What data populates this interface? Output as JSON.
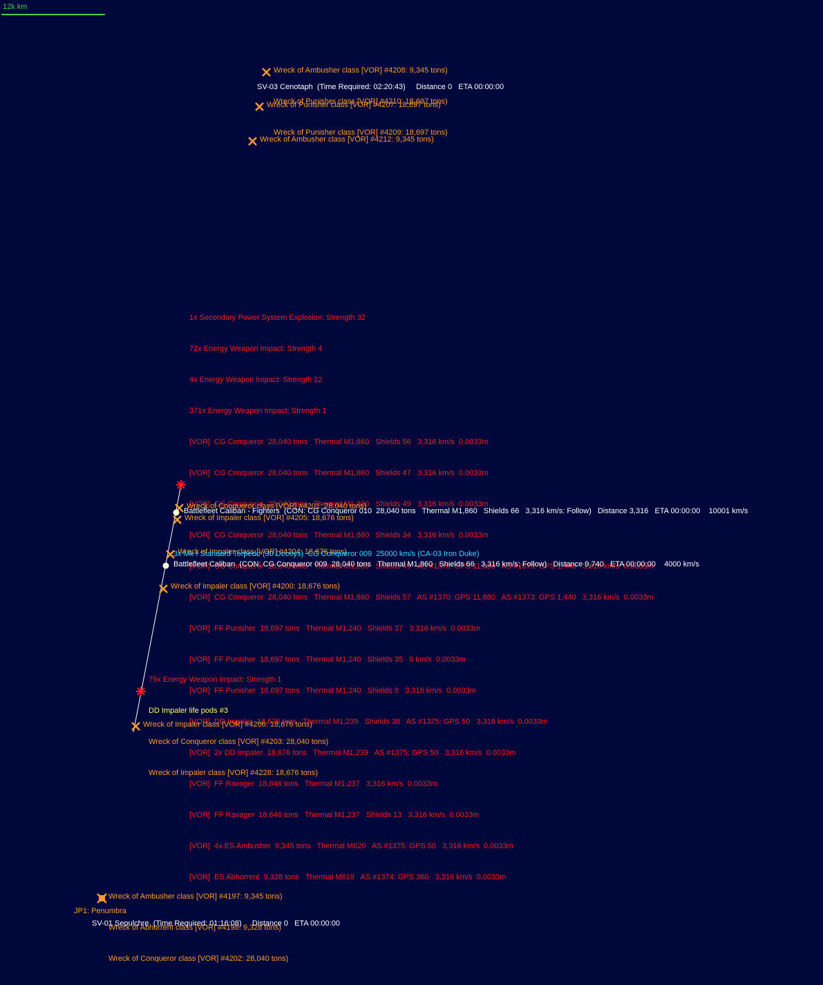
{
  "scale": {
    "label": "12k km"
  },
  "colors": {
    "background": "#00073a",
    "wreck": "#ff9c28",
    "impact": "#ff1c1c",
    "fleet": "#ffffff",
    "life_pod": "#ffff60",
    "missile": "#40d8ff",
    "scale_bar": "#3cd23c"
  },
  "icons": {
    "wreck": "x-cross-icon",
    "impact": "starburst-icon",
    "fleet": "dot-icon",
    "jump_point": "square-x-icon"
  },
  "top_cluster": {
    "wrecks": [
      "Wreck of Ambusher class [VOR] #4208: 9,345 tons)",
      "Wreck of Punisher class [VOR] #4210: 18,697 tons)",
      "Wreck of Punisher class [VOR] #4209: 18,697 tons)"
    ],
    "waypoint": "SV-03 Cenotaph  (Time Required: 02:20:43)     Distance 0   ETA 00:00:00"
  },
  "wreck_4207": "Wreck of Punisher class [VOR] #4207: 18,697 tons)",
  "wreck_4212": "Wreck of Ambusher class [VOR] #4212: 9,345 tons)",
  "combat_log": [
    "1x Secondary Power System Explosion: Strength 32",
    "72x Energy Weapon Impact: Strength 4",
    "4x Energy Weapon Impact: Strength 12",
    "371x Energy Weapon Impact: Strength 1",
    "[VOR]  CG Conqueror  28,040 tons   Thermal M1,860   Shields 56   3,316 km/s  0.0033m",
    "[VOR]  CG Conqueror  28,040 tons   Thermal M1,860   Shields 47   3,316 km/s  0.0033m",
    "[VOR]  CG Conqueror  28,040 tons   Thermal M1,860   Shields 49   3,316 km/s  0.0033m",
    "[VOR]  CG Conqueror  28,040 tons   Thermal M1,860   Shields 34   3,316 km/s  0.0033m",
    "[VOR]  CG Conqueror  28,040 tons   Thermal M1,860   Shields 49   AS #1370: GPS 11,880   AS #1373: GPS 1,440   3,316 km/s  0.0033m",
    "[VOR]  CG Conqueror  28,040 tons   Thermal M1,860   Shields 57   AS #1370: GPS 11,880   AS #1373: GPS 1,440   3,316 km/s  0.0033m",
    "[VOR]  FF Punisher  18,697 tons   Thermal M1,240   Shields 37   3,316 km/s  0.0033m",
    "[VOR]  FF Punisher  18,697 tons   Thermal M1,240   Shields 35   0 km/s  0.0033m",
    "[VOR]  FF Punisher  18,697 tons   Thermal M1,240   Shields 8   3,316 km/s  0.0033m",
    "[VOR]  DD Impaler  18,676 tons   Thermal M1,239   Shields 38   AS #1375: GPS 50   3,316 km/s  0.0033m",
    "[VOR]  2x DD Impaler  18,676 tons   Thermal M1,239   AS #1375: GPS 50   3,316 km/s  0.0033m",
    "[VOR]  FF Ravager  18,646 tons   Thermal M1,237   3,316 km/s  0.0033m",
    "[VOR]  FF Ravager  18,646 tons   Thermal M1,237   Shields 13   3,316 km/s  0.0033m",
    "[VOR]  4x ES Ambusher  9,345 tons   Thermal M620   AS #1375: GPS 50   3,316 km/s  0.0033m",
    "[VOR]  ES Abhorrent  9,328 tons   Thermal M619   AS #1374: GPS 360   3,316 km/s  0.0033m"
  ],
  "fighters": {
    "wreck_4201": "Wreck of Conqueror class [VOR] #4201: 28,040 tons)",
    "fleet": "Battlefleet Caliban - Fighters  (CON: CG Conqueror 010  28,040 tons   Thermal M1,860   Shields 66   3,316 km/s: Follow)   Distance 3,316   ETA 00:00:00    10001 km/s",
    "wreck_4205": "Wreck of Impaler class [VOR] #4205: 18,676 tons)"
  },
  "main_fleet": {
    "wreck_4204": "Wreck of Impaler class [VOR] #4204: 18,676 tons)",
    "missile": "3x Mk I Standard Torpedo (30 Decoys)  CG Conqueror 009  25000 km/s (CA-03 Iron Duke)",
    "fleet": "Battlefleet Caliban  (CON: CG Conqueror 009  28,040 tons   Thermal M1,860   Shields 66   3,316 km/s: Follow)   Distance 9,740   ETA 00:00:00    4000 km/s"
  },
  "wreck_4200": "Wreck of Impaler class [VOR] #4200: 18,676 tons)",
  "lower_cluster": {
    "impact": "79x Energy Weapon Impact: Strength 1",
    "life_pods": "DD Impaler life pods #3",
    "wreck_4203": "Wreck of Conqueror class [VOR] #4203: 28,040 tons)",
    "wreck_4228": "Wreck of Impaler class [VOR] #4228: 18,676 tons)"
  },
  "wreck_4206": "Wreck of Impaler class [VOR] #4206: 18,676 tons)",
  "bottom_cluster": {
    "wrecks": [
      "Wreck of Ambusher class [VOR] #4197: 9,345 tons)",
      "Wreck of Abhorrent class [VOR] #4198: 9,328 tons)",
      "Wreck of Conqueror class [VOR] #4202: 28,040 tons)"
    ],
    "jump_point": "JP1: Penumbra",
    "waypoint": "SV-01 Sepulchre  (Time Required: 01:16:08)     Distance 0   ETA 00:00:00"
  }
}
